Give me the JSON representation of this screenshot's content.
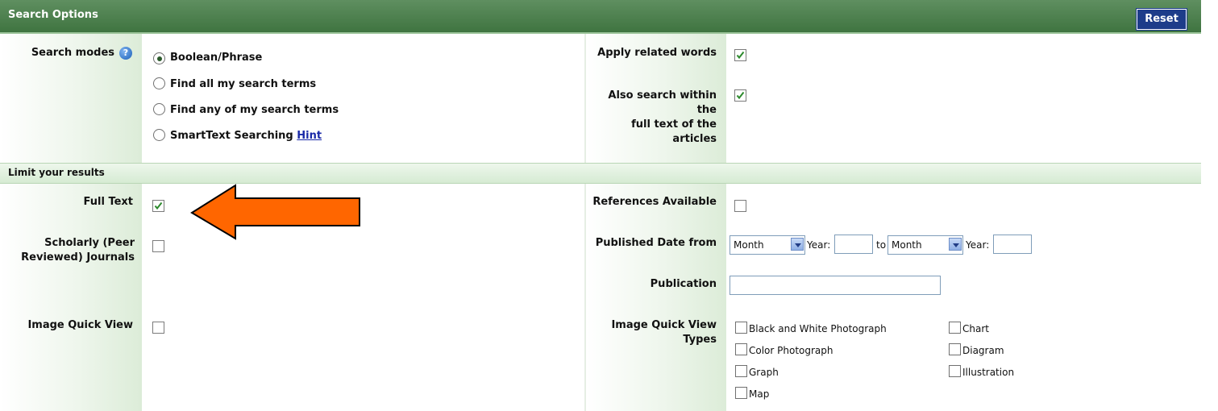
{
  "header": {
    "title": "Search Options",
    "reset_label": "Reset"
  },
  "search_modes": {
    "label": "Search modes",
    "options": [
      {
        "label": "Boolean/Phrase",
        "selected": true
      },
      {
        "label": "Find all my search terms",
        "selected": false
      },
      {
        "label": "Find any of my search terms",
        "selected": false
      },
      {
        "label": "SmartText Searching",
        "selected": false,
        "link": "Hint"
      }
    ]
  },
  "apply_related": {
    "label": "Apply related words",
    "checked": true
  },
  "also_search_fulltext": {
    "label_line1": "Also search within the",
    "label_line2": "full text of the articles",
    "checked": true
  },
  "limit": {
    "title": "Limit your results",
    "full_text": {
      "label": "Full Text",
      "checked": true
    },
    "scholarly": {
      "label_line1": "Scholarly (Peer",
      "label_line2": "Reviewed) Journals",
      "checked": false
    },
    "image_quick_view": {
      "label": "Image Quick View",
      "checked": false
    },
    "references_available": {
      "label": "References Available",
      "checked": false
    },
    "published_date": {
      "label": "Published Date from",
      "month_from": "Month",
      "year_label": "Year:",
      "to_label": "to",
      "month_to": "Month",
      "year_label2": "Year:"
    },
    "publication": {
      "label": "Publication",
      "value": ""
    },
    "image_quick_view_types": {
      "label": "Image Quick View Types",
      "items": [
        "Black and White Photograph",
        "Chart",
        "Color Photograph",
        "Diagram",
        "Graph",
        "Illustration",
        "Map"
      ]
    }
  },
  "colors": {
    "header": "#3f7440",
    "reset": "#1d3c8a",
    "arrow": "#ff6600",
    "hint_link": "#1a2aa8"
  }
}
